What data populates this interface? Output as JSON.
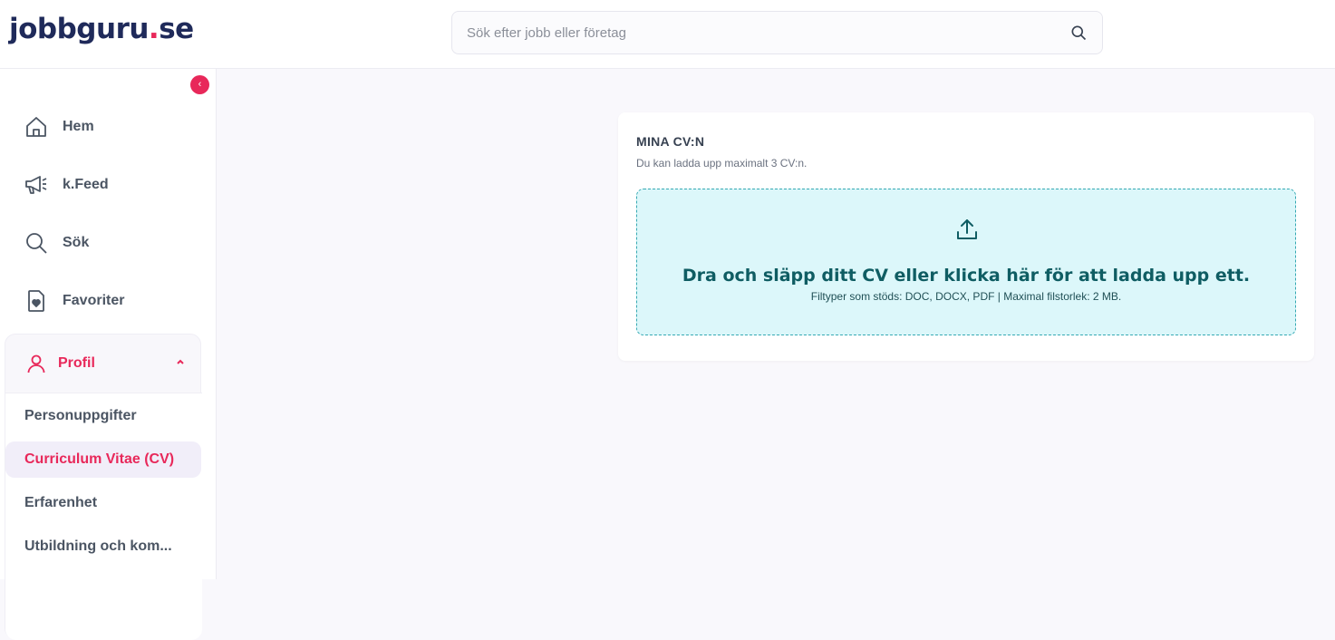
{
  "header": {
    "logo_main": "jobbguru",
    "logo_dot": ".",
    "logo_tld": "se",
    "search_placeholder": "Sök efter jobb eller företag",
    "search_icon": "search-icon"
  },
  "sidebar": {
    "collapse_label": "‹",
    "items": [
      {
        "label": "Hem",
        "icon": "home-icon"
      },
      {
        "label": "k.Feed",
        "icon": "megaphone-icon"
      },
      {
        "label": "Sök",
        "icon": "search-icon"
      },
      {
        "label": "Favoriter",
        "icon": "heart-document-icon"
      }
    ],
    "profile": {
      "label": "Profil",
      "icon": "user-icon",
      "expanded": true,
      "subitems": [
        {
          "label": "Personuppgifter",
          "active": false
        },
        {
          "label": "Curriculum Vitae (CV)",
          "active": true
        },
        {
          "label": "Erfarenhet",
          "active": false
        },
        {
          "label": "Utbildning och kom...",
          "active": false
        }
      ]
    }
  },
  "main": {
    "card_title": "MINA CV:N",
    "card_subtitle": "Du kan ladda upp maximalt 3 CV:n.",
    "dropzone": {
      "icon": "upload-icon",
      "title": "Dra och släpp ditt CV eller klicka här för att ladda upp ett.",
      "subtitle": "Filtyper som stöds: DOC, DOCX, PDF | Maximal filstorlek: 2 MB."
    }
  },
  "colors": {
    "accent": "#e8285a",
    "brand_navy": "#1f2a5a",
    "dropzone_bg": "#dcf7fa",
    "dropzone_text": "#0f5d63"
  }
}
